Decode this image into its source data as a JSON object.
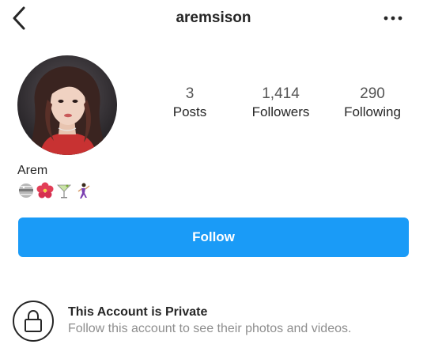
{
  "header": {
    "username": "aremsison",
    "back_icon": "chevron-left-icon",
    "more_icon": "more-horizontal-icon"
  },
  "profile": {
    "avatar_icon": "profile-photo",
    "stats": [
      {
        "value": "3",
        "label": "Posts"
      },
      {
        "value": "1,414",
        "label": "Followers"
      },
      {
        "value": "290",
        "label": "Following"
      }
    ],
    "name": "Arem",
    "bio_emojis": [
      "disco-ball-emoji",
      "hibiscus-emoji",
      "cocktail-glass-emoji",
      "dancing-woman-emoji"
    ]
  },
  "follow_button": {
    "label": "Follow",
    "color": "#1a9bf7"
  },
  "private_notice": {
    "icon": "lock-icon",
    "title": "This Account is Private",
    "subtitle": "Follow this account to see their photos and videos."
  }
}
